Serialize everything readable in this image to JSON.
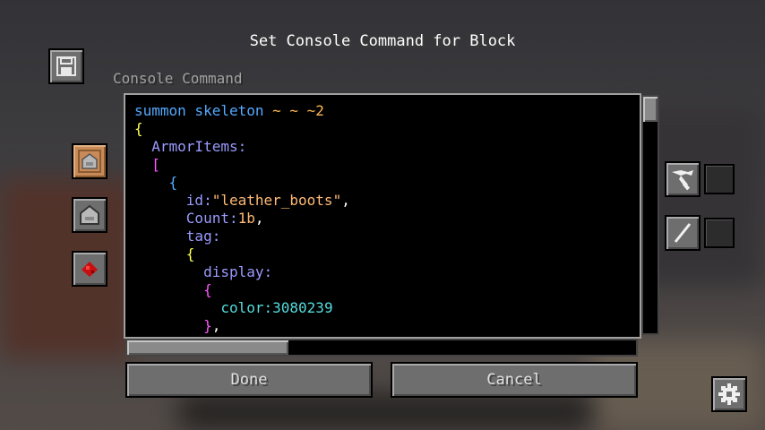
{
  "title": "Set Console Command for Block",
  "field_label": "Console Command",
  "code_lines": [
    [
      {
        "t": "summon skeleton ",
        "c": "c-cmd"
      },
      {
        "t": "~ ~ ~2",
        "c": "c-tilde"
      }
    ],
    [
      {
        "t": "{",
        "c": "c-brace"
      }
    ],
    [
      {
        "t": "  ArmorItems",
        "c": "c-key"
      },
      {
        "t": ":",
        "c": "c-colon"
      }
    ],
    [
      {
        "t": "  [",
        "c": "c-bracket"
      }
    ],
    [
      {
        "t": "    {",
        "c": "c-cmd"
      }
    ],
    [
      {
        "t": "      id",
        "c": "c-key"
      },
      {
        "t": ":",
        "c": "c-colon"
      },
      {
        "t": "\"leather_boots\"",
        "c": "c-str"
      },
      {
        "t": ",",
        "c": "c-comma"
      }
    ],
    [
      {
        "t": "      Count",
        "c": "c-key"
      },
      {
        "t": ":",
        "c": "c-colon"
      },
      {
        "t": "1b",
        "c": "c-num"
      },
      {
        "t": ",",
        "c": "c-comma"
      }
    ],
    [
      {
        "t": "      tag",
        "c": "c-key"
      },
      {
        "t": ":",
        "c": "c-colon"
      }
    ],
    [
      {
        "t": "      {",
        "c": "c-brace"
      }
    ],
    [
      {
        "t": "        display",
        "c": "c-key"
      },
      {
        "t": ":",
        "c": "c-colon"
      }
    ],
    [
      {
        "t": "        {",
        "c": "c-bracket"
      }
    ],
    [
      {
        "t": "          color",
        "c": "c-cyan"
      },
      {
        "t": ":",
        "c": "c-cyan"
      },
      {
        "t": "3080239",
        "c": "c-cyan"
      }
    ],
    [
      {
        "t": "        }",
        "c": "c-bracket"
      },
      {
        "t": ",",
        "c": "c-comma"
      }
    ]
  ],
  "buttons": {
    "done": "Done",
    "cancel": "Cancel"
  },
  "icons": {
    "save": "floppy-disk-icon",
    "command_block": "command-block-icon",
    "structure_block": "structure-block-icon",
    "redstone": "redstone-dust-icon",
    "pickaxe": "pickaxe-icon",
    "wand": "stick-icon",
    "settings": "gear-icon"
  },
  "colors": {
    "command": "#55aaff",
    "tilde": "#ffb84d",
    "brace": "#ffff55",
    "bracket": "#ff55ff",
    "key": "#9a9aff",
    "string": "#ffbb77",
    "number_cyan": "#55dddd"
  }
}
